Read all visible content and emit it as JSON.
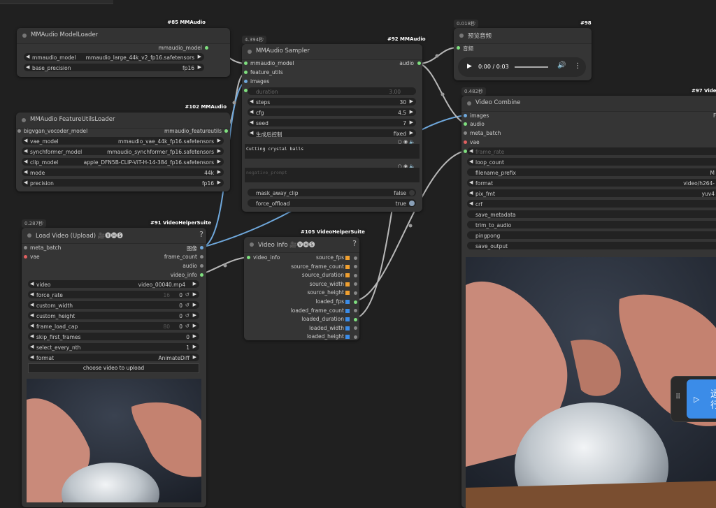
{
  "canvas": {
    "nodes": {
      "model_loader": {
        "badge": "#85 MMAudio",
        "title": "MMAudio ModelLoader",
        "output": "mmaudio_model",
        "widgets": [
          {
            "name": "mmaudio_model",
            "value": "mmaudio_large_44k_v2_fp16.safetensors"
          },
          {
            "name": "base_precision",
            "value": "fp16"
          }
        ]
      },
      "feature_loader": {
        "badge": "#102 MMAudio",
        "title": "MMAudio FeatureUtilsLoader",
        "input": "bigvgan_vocoder_model",
        "output": "mmaudio_featureutils",
        "widgets": [
          {
            "name": "vae_model",
            "value": "mmaudio_vae_44k_fp16.safetensors"
          },
          {
            "name": "synchformer_model",
            "value": "mmaudio_synchformer_fp16.safetensors"
          },
          {
            "name": "clip_model",
            "value": "apple_DFN5B-CLIP-ViT-H-14-384_fp16.safetensors"
          },
          {
            "name": "mode",
            "value": "44k"
          },
          {
            "name": "precision",
            "value": "fp16"
          }
        ]
      },
      "sampler": {
        "time": "4.394秒",
        "badge": "#92 MMAudio",
        "title": "MMAudio Sampler",
        "inputs": [
          "mmaudio_model",
          "feature_utils",
          "images"
        ],
        "output": "audio",
        "duration": {
          "name": "duration",
          "value": "3.00"
        },
        "widgets": [
          {
            "name": "steps",
            "value": "30"
          },
          {
            "name": "cfg",
            "value": "4.5"
          },
          {
            "name": "seed",
            "value": "7"
          },
          {
            "name": "生成后控制",
            "value": "fixed"
          }
        ],
        "prompt": "Cutting crystal balls",
        "negative_prompt": "negative_prompt",
        "toggles": [
          {
            "name": "mask_away_clip",
            "value": "false"
          },
          {
            "name": "force_offload",
            "value": "true"
          }
        ]
      },
      "preview_audio": {
        "time": "0.018秒",
        "badge": "#98",
        "title": "预览音频",
        "input": "音频",
        "player_time": "0:00 / 0:03",
        "progress": 0
      },
      "video_combine": {
        "time": "0.482秒",
        "badge": "#97 VideoH",
        "title": "Video Combine",
        "inputs": [
          "images",
          "audio",
          "meta_batch",
          "vae"
        ],
        "output_hint": "F",
        "frame_rate": "frame_rate",
        "widgets": [
          {
            "name": "loop_count",
            "value": ""
          },
          {
            "name": "filename_prefix",
            "value": "M"
          },
          {
            "name": "format",
            "value": "video/h264-"
          },
          {
            "name": "pix_fmt",
            "value": "yuv4"
          },
          {
            "name": "crf",
            "value": ""
          },
          {
            "name": "save_metadata",
            "value": ""
          },
          {
            "name": "trim_to_audio",
            "value": ""
          },
          {
            "name": "pingpong",
            "value": ""
          },
          {
            "name": "save_output",
            "value": ""
          }
        ]
      },
      "load_video": {
        "time": "0.287秒",
        "badge": "#91 VideoHelperSuite",
        "title": "Load Video (Upload) 🎥🅥🅗🅢",
        "help": "?",
        "inputs": [
          "meta_batch",
          "vae"
        ],
        "outputs": [
          "图像",
          "frame_count",
          "audio",
          "video_info"
        ],
        "widgets": [
          {
            "name": "video",
            "value": "video_00040.mp4"
          },
          {
            "name": "force_rate",
            "value": "0",
            "hint": "16"
          },
          {
            "name": "custom_width",
            "value": "0"
          },
          {
            "name": "custom_height",
            "value": "0"
          },
          {
            "name": "frame_load_cap",
            "value": "0",
            "hint": "80"
          },
          {
            "name": "skip_first_frames",
            "value": "0"
          },
          {
            "name": "select_every_nth",
            "value": "1"
          },
          {
            "name": "format",
            "value": "AnimateDiff"
          }
        ],
        "upload": "choose video to upload"
      },
      "video_info": {
        "badge": "#105 VideoHelperSuite",
        "title": "Video Info 🎥🅥🅗🅢",
        "help": "?",
        "input": "video_info",
        "outputs": [
          {
            "name": "source_fps",
            "color": "#f0a030"
          },
          {
            "name": "source_frame_count",
            "color": "#f0a030"
          },
          {
            "name": "source_duration",
            "color": "#f0a030"
          },
          {
            "name": "source_width",
            "color": "#f0a030"
          },
          {
            "name": "source_height",
            "color": "#f0a030"
          },
          {
            "name": "loaded_fps",
            "color": "#3b8ce8"
          },
          {
            "name": "loaded_frame_count",
            "color": "#3b8ce8"
          },
          {
            "name": "loaded_duration",
            "color": "#3b8ce8"
          },
          {
            "name": "loaded_width",
            "color": "#3b8ce8"
          },
          {
            "name": "loaded_height",
            "color": "#3b8ce8"
          }
        ]
      }
    },
    "run_panel": {
      "label": "运行"
    },
    "colors": {
      "link_green": "#9bd49b",
      "link_blue": "#6fa8dc",
      "link_gray": "#a0a0a0",
      "accent": "#3b8ce8"
    }
  }
}
